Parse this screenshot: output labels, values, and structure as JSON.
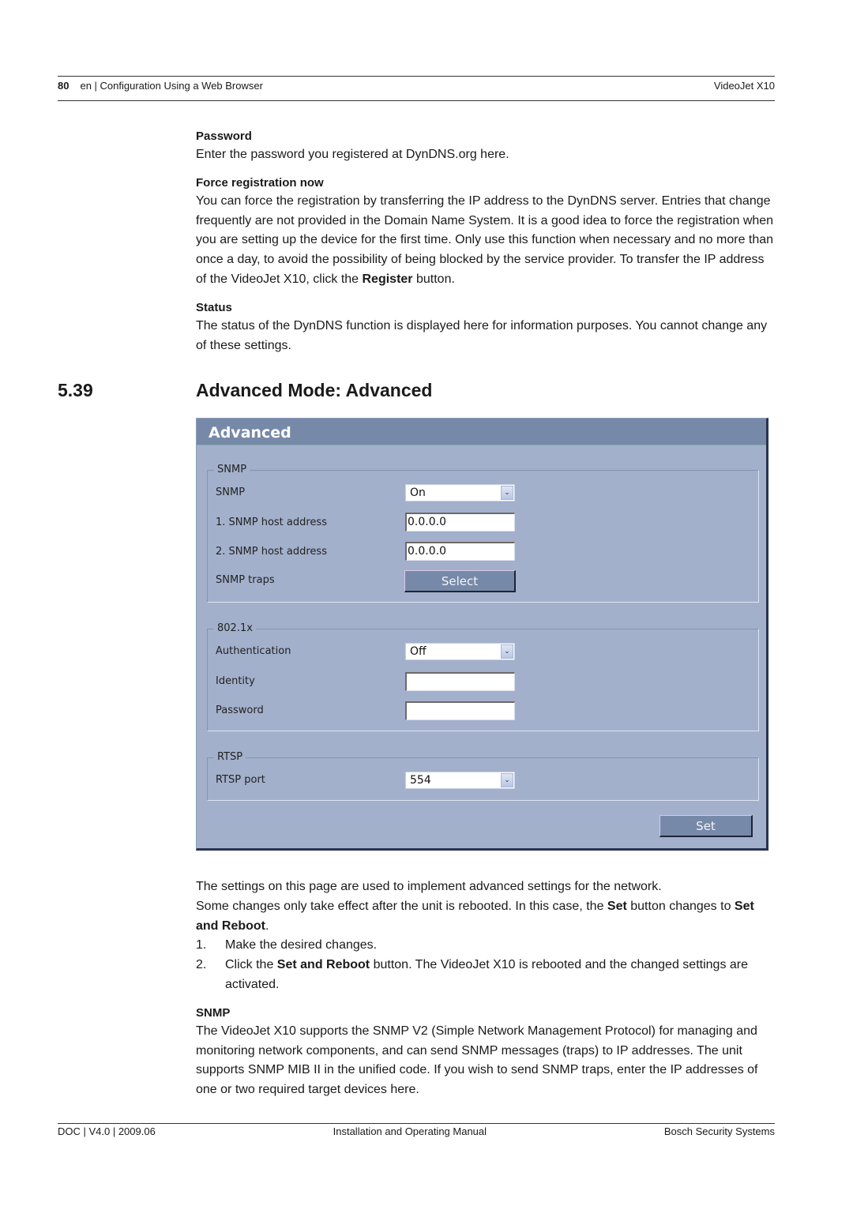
{
  "header": {
    "page_number": "80",
    "chapter": "en | Configuration Using a Web Browser",
    "product": "VideoJet X10"
  },
  "intro": {
    "password": {
      "heading": "Password",
      "text": "Enter the password you registered at DynDNS.org here."
    },
    "force_registration": {
      "heading": "Force registration now",
      "text_before": "You can force the registration by transferring the IP address to the DynDNS server. Entries that change frequently are not provided in the Domain Name System. It is a good idea to force the registration when you are setting up the device for the first time. Only use this function when necessary and no more than once a day, to avoid the possibility of being blocked by the service provider. To transfer the IP address of the VideoJet X10, click the ",
      "bold": "Register",
      "text_after": " button."
    },
    "status": {
      "heading": "Status",
      "text": "The status of the DynDNS function is displayed here for information purposes. You cannot change any of these settings."
    }
  },
  "section": {
    "number": "5.39",
    "title": "Advanced Mode: Advanced"
  },
  "panel": {
    "title": "Advanced",
    "snmp": {
      "legend": "SNMP",
      "snmp_label": "SNMP",
      "snmp_value": "On",
      "host1_label": "1. SNMP host address",
      "host1_value": "0.0.0.0",
      "host2_label": "2. SNMP host address",
      "host2_value": "0.0.0.0",
      "traps_label": "SNMP traps",
      "traps_button": "Select"
    },
    "dot1x": {
      "legend": "802.1x",
      "auth_label": "Authentication",
      "auth_value": "Off",
      "identity_label": "Identity",
      "identity_value": "",
      "password_label": "Password",
      "password_value": ""
    },
    "rtsp": {
      "legend": "RTSP",
      "port_label": "RTSP port",
      "port_value": "554"
    },
    "set_button": "Set",
    "dropdown_glyph": "⌄"
  },
  "after": {
    "line1": "The settings on this page are used to implement advanced settings for the network.",
    "line2_before": "Some changes only take effect after the unit is rebooted. In this case, the ",
    "line2_bold1": "Set",
    "line2_mid": " button changes to ",
    "line2_bold2": "Set and Reboot",
    "line2_end": ".",
    "steps": [
      {
        "num": "1.",
        "text": "Make the desired changes."
      },
      {
        "num": "2.",
        "before": "Click the ",
        "bold": "Set and Reboot",
        "after": " button. The VideoJet X10 is rebooted and the changed settings are activated."
      }
    ],
    "snmp_heading": "SNMP",
    "snmp_text": "The VideoJet X10 supports the SNMP V2 (Simple Network Management Protocol) for managing and monitoring network components, and can send SNMP messages (traps) to IP addresses. The unit supports SNMP MIB II in the unified code. If you wish to send SNMP traps, enter the IP addresses of one or two required target devices here."
  },
  "footer": {
    "doc": "DOC | V4.0 | 2009.06",
    "manual": "Installation and Operating Manual",
    "company": "Bosch Security Systems"
  }
}
